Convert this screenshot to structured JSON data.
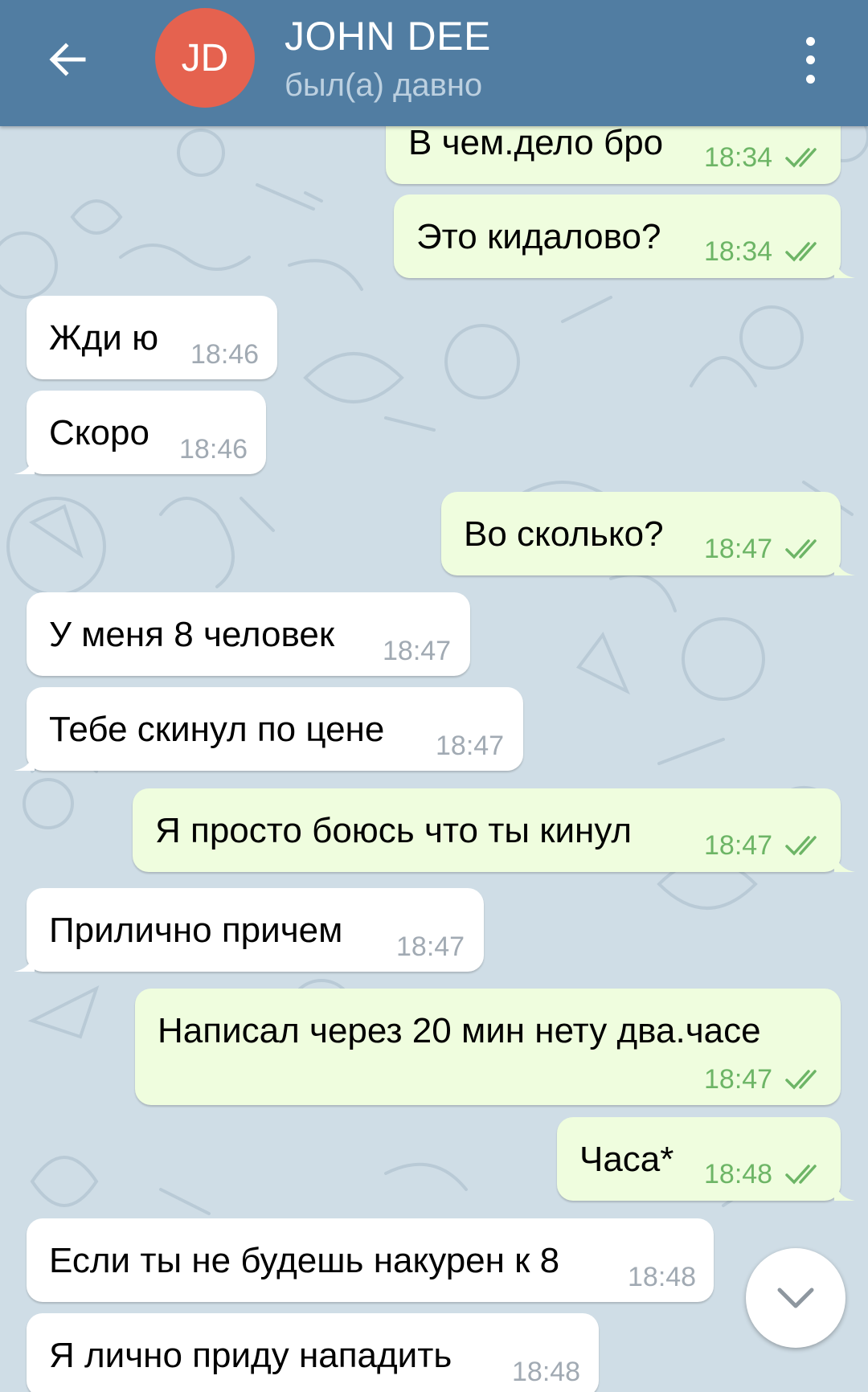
{
  "header": {
    "avatar_initials": "JD",
    "avatar_color": "#e5624f",
    "name": "JOHN DEE",
    "status": "был(а) давно",
    "bar_color": "#517da2",
    "back_icon": "arrow-left-icon",
    "menu_icon": "more-vert-icon"
  },
  "messages": [
    {
      "dir": "out",
      "text": "В чем.дело бро",
      "time": "18:34",
      "read": true
    },
    {
      "dir": "out",
      "text": "Это кидалово?",
      "time": "18:34",
      "read": true
    },
    {
      "dir": "in",
      "text": "Жди ю",
      "time": "18:46"
    },
    {
      "dir": "in",
      "text": "Скоро",
      "time": "18:46"
    },
    {
      "dir": "out",
      "text": "Во сколько?",
      "time": "18:47",
      "read": true
    },
    {
      "dir": "in",
      "text": "У меня 8 человек",
      "time": "18:47"
    },
    {
      "dir": "in",
      "text": "Тебе скинул по цене",
      "time": "18:47"
    },
    {
      "dir": "out",
      "text": "Я просто боюсь что ты кинул",
      "time": "18:47",
      "read": true
    },
    {
      "dir": "in",
      "text": "Прилично причем",
      "time": "18:47"
    },
    {
      "dir": "out",
      "text": "Написал через 20 мин нету два.часе",
      "time": "18:47",
      "read": true
    },
    {
      "dir": "out",
      "text": "Часа*",
      "time": "18:48",
      "read": true
    },
    {
      "dir": "in",
      "text": "Если ты не будешь накурен к 8",
      "time": "18:48"
    },
    {
      "dir": "in",
      "text": "Я лично приду нападить",
      "time": "18:48"
    }
  ],
  "colors": {
    "chat_bg": "#cfdde6",
    "incoming_bubble": "#ffffff",
    "outgoing_bubble": "#effdde",
    "outgoing_time": "#6db566",
    "incoming_time": "#a1aab3"
  },
  "scroll_button_icon": "chevron-down-icon"
}
